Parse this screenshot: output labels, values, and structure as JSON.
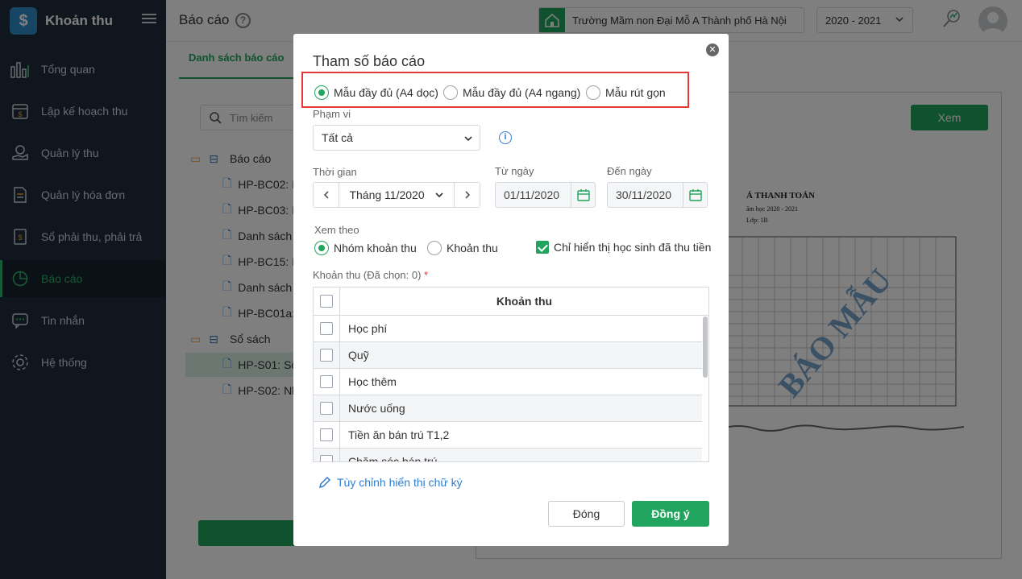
{
  "app": {
    "title": "Khoản thu",
    "logo_glyph": "$"
  },
  "sidebar": {
    "items": [
      {
        "label": "Tổng quan",
        "icon": "bar-chart-icon"
      },
      {
        "label": "Lập kế hoạch thu",
        "icon": "calendar-money-icon"
      },
      {
        "label": "Quản lý thu",
        "icon": "hand-coin-icon"
      },
      {
        "label": "Quản lý hóa đơn",
        "icon": "invoice-icon"
      },
      {
        "label": "Sổ phải thu, phải trả",
        "icon": "ledger-icon"
      },
      {
        "label": "Báo cáo",
        "icon": "pie-chart-icon",
        "active": true
      },
      {
        "label": "Tin nhắn",
        "icon": "chat-icon"
      },
      {
        "label": "Hệ thống",
        "icon": "gear-icon"
      }
    ]
  },
  "topbar": {
    "page_title": "Báo cáo",
    "school": "Trường Mầm non Đại Mỗ A Thành phố Hà Nội",
    "year": "2020 - 2021"
  },
  "content": {
    "tab": "Danh sách báo cáo",
    "search_placeholder": "Tìm kiếm",
    "tree": [
      {
        "label": "Báo cáo",
        "type": "folder"
      },
      {
        "label": "HP-BC02: I",
        "type": "file"
      },
      {
        "label": "HP-BC03: I",
        "type": "file"
      },
      {
        "label": "Danh sách",
        "type": "file"
      },
      {
        "label": "HP-BC15: I",
        "type": "file"
      },
      {
        "label": "Danh sách",
        "type": "file"
      },
      {
        "label": "HP-BC01a:",
        "type": "file"
      },
      {
        "label": "Sổ sách",
        "type": "folder"
      },
      {
        "label": "HP-S01: Số",
        "type": "file",
        "selected": true
      },
      {
        "label": "HP-S02: Nh",
        "type": "file"
      }
    ],
    "view_button": "Xem",
    "paper_title": "Á THANH TOÁN",
    "paper_subtitle": "ăm học 2020 - 2021",
    "paper_class": "Lớp: 1B",
    "watermark": "BÁO MẪU"
  },
  "modal": {
    "title": "Tham số báo cáo",
    "templates": [
      {
        "label": "Mẫu đầy đủ (A4 dọc)",
        "selected": true
      },
      {
        "label": "Mẫu đầy đủ (A4 ngang)",
        "selected": false
      },
      {
        "label": "Mẫu rút gọn",
        "selected": false
      }
    ],
    "scope_label": "Phạm vi",
    "scope_value": "Tất cả",
    "time_label": "Thời gian",
    "month_value": "Tháng 11/2020",
    "from_label": "Từ ngày",
    "from_value": "01/11/2020",
    "to_label": "Đến ngày",
    "to_value": "30/11/2020",
    "view_by_label": "Xem theo",
    "view_by": [
      {
        "label": "Nhóm khoản thu",
        "selected": true
      },
      {
        "label": "Khoản thu",
        "selected": false
      }
    ],
    "only_paid_label": "Chỉ hiển thị học sinh đã thu tiền",
    "only_paid_checked": true,
    "fees_label": "Khoản thu (Đã chọn: 0)",
    "required_mark": "*",
    "grid_header": "Khoản thu",
    "fees": [
      "Học phí",
      "Quỹ",
      "Học thêm",
      "Nước uống",
      "Tiền ăn bán trú T1,2",
      "Chăm sóc bán trú"
    ],
    "signature_link": "Tùy chỉnh hiển thị chữ ký",
    "close_button": "Đóng",
    "ok_button": "Đồng ý"
  },
  "colors": {
    "accent": "#21a45d",
    "sidebar_bg": "#1e2d3d",
    "highlight": "#e53935",
    "link": "#2e7dd1"
  }
}
